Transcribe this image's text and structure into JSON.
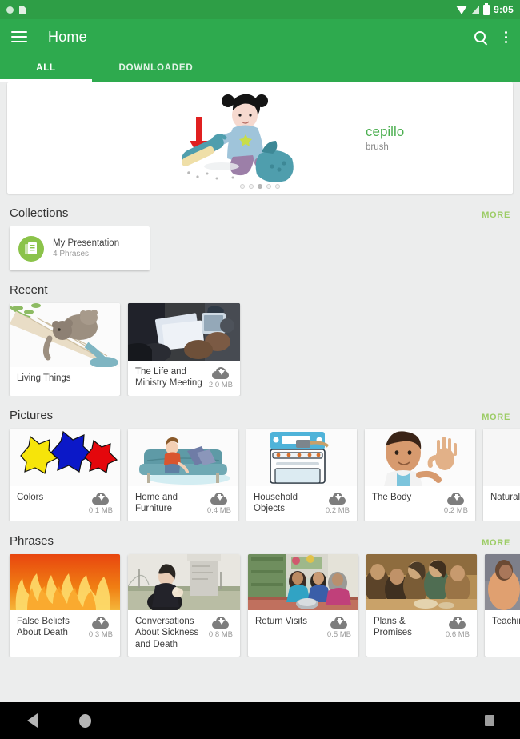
{
  "status_bar": {
    "time": "9:05",
    "icons": [
      "notification-dot",
      "sim-card",
      "wifi",
      "signal",
      "battery"
    ]
  },
  "app_bar": {
    "title": "Home",
    "menu_icon": "hamburger-menu-icon",
    "search_icon": "search-icon",
    "overflow_icon": "overflow-menu-icon"
  },
  "tabs": [
    {
      "label": "ALL",
      "active": true
    },
    {
      "label": "DOWNLOADED",
      "active": false
    }
  ],
  "hero": {
    "word": "cepillo",
    "translation": "brush",
    "illustration": "girl-sweeping-with-brush-and-dustpan",
    "pager_dots": 5,
    "pager_active_index": 2
  },
  "sections": [
    {
      "title": "Collections",
      "more_label": "MORE",
      "items": [
        {
          "name": "My Presentation",
          "subtitle": "4 Phrases",
          "icon": "document-list-icon"
        }
      ]
    },
    {
      "title": "Recent",
      "more_label": "",
      "items": [
        {
          "title": "Living Things",
          "size": "",
          "downloadable": false,
          "thumb": "koalas-on-branch-illustration"
        },
        {
          "title": "The Life and Ministry Meeting",
          "size": "2.0 MB",
          "downloadable": true,
          "thumb": "people-holding-workbooks-photo"
        }
      ]
    },
    {
      "title": "Pictures",
      "more_label": "MORE",
      "items": [
        {
          "title": "Colors",
          "size": "0.1 MB",
          "downloadable": true,
          "thumb": "paint-splats-yellow-blue-red"
        },
        {
          "title": "Home and Furniture",
          "size": "0.4 MB",
          "downloadable": true,
          "thumb": "child-on-teal-sofa-illustration"
        },
        {
          "title": "Household Objects",
          "size": "0.2 MB",
          "downloadable": true,
          "thumb": "stove-with-pot-illustration"
        },
        {
          "title": "The Body",
          "size": "0.2 MB",
          "downloadable": true,
          "thumb": "boy-waving-illustration"
        },
        {
          "title": "Natural Pro",
          "size": "",
          "downloadable": false,
          "thumb": "blank-thumbnail"
        }
      ]
    },
    {
      "title": "Phrases",
      "more_label": "MORE",
      "items": [
        {
          "title": "False Beliefs About Death",
          "size": "0.3 MB",
          "downloadable": true,
          "thumb": "orange-flames-illustration"
        },
        {
          "title": "Conversations About Sickness and Death",
          "size": "0.8 MB",
          "downloadable": true,
          "thumb": "woman-at-gravestone-photo"
        },
        {
          "title": "Return Visits",
          "size": "0.5 MB",
          "downloadable": true,
          "thumb": "women-sitting-on-mat-photo"
        },
        {
          "title": "Plans & Promises",
          "size": "0.6 MB",
          "downloadable": true,
          "thumb": "group-around-table-photo"
        },
        {
          "title": "Teaching",
          "size": "",
          "downloadable": false,
          "thumb": "two-people-conversing-photo"
        }
      ]
    }
  ],
  "nav_bar": {
    "back": "back-icon",
    "home": "home-icon",
    "recents": "recents-icon"
  },
  "colors": {
    "status_bar": "#2e9e46",
    "app_bar": "#2eaa4e",
    "accent_word": "#4caf50",
    "more_link": "#9ccc65",
    "collection_icon": "#8bc34a",
    "page_bg": "#eceded"
  }
}
